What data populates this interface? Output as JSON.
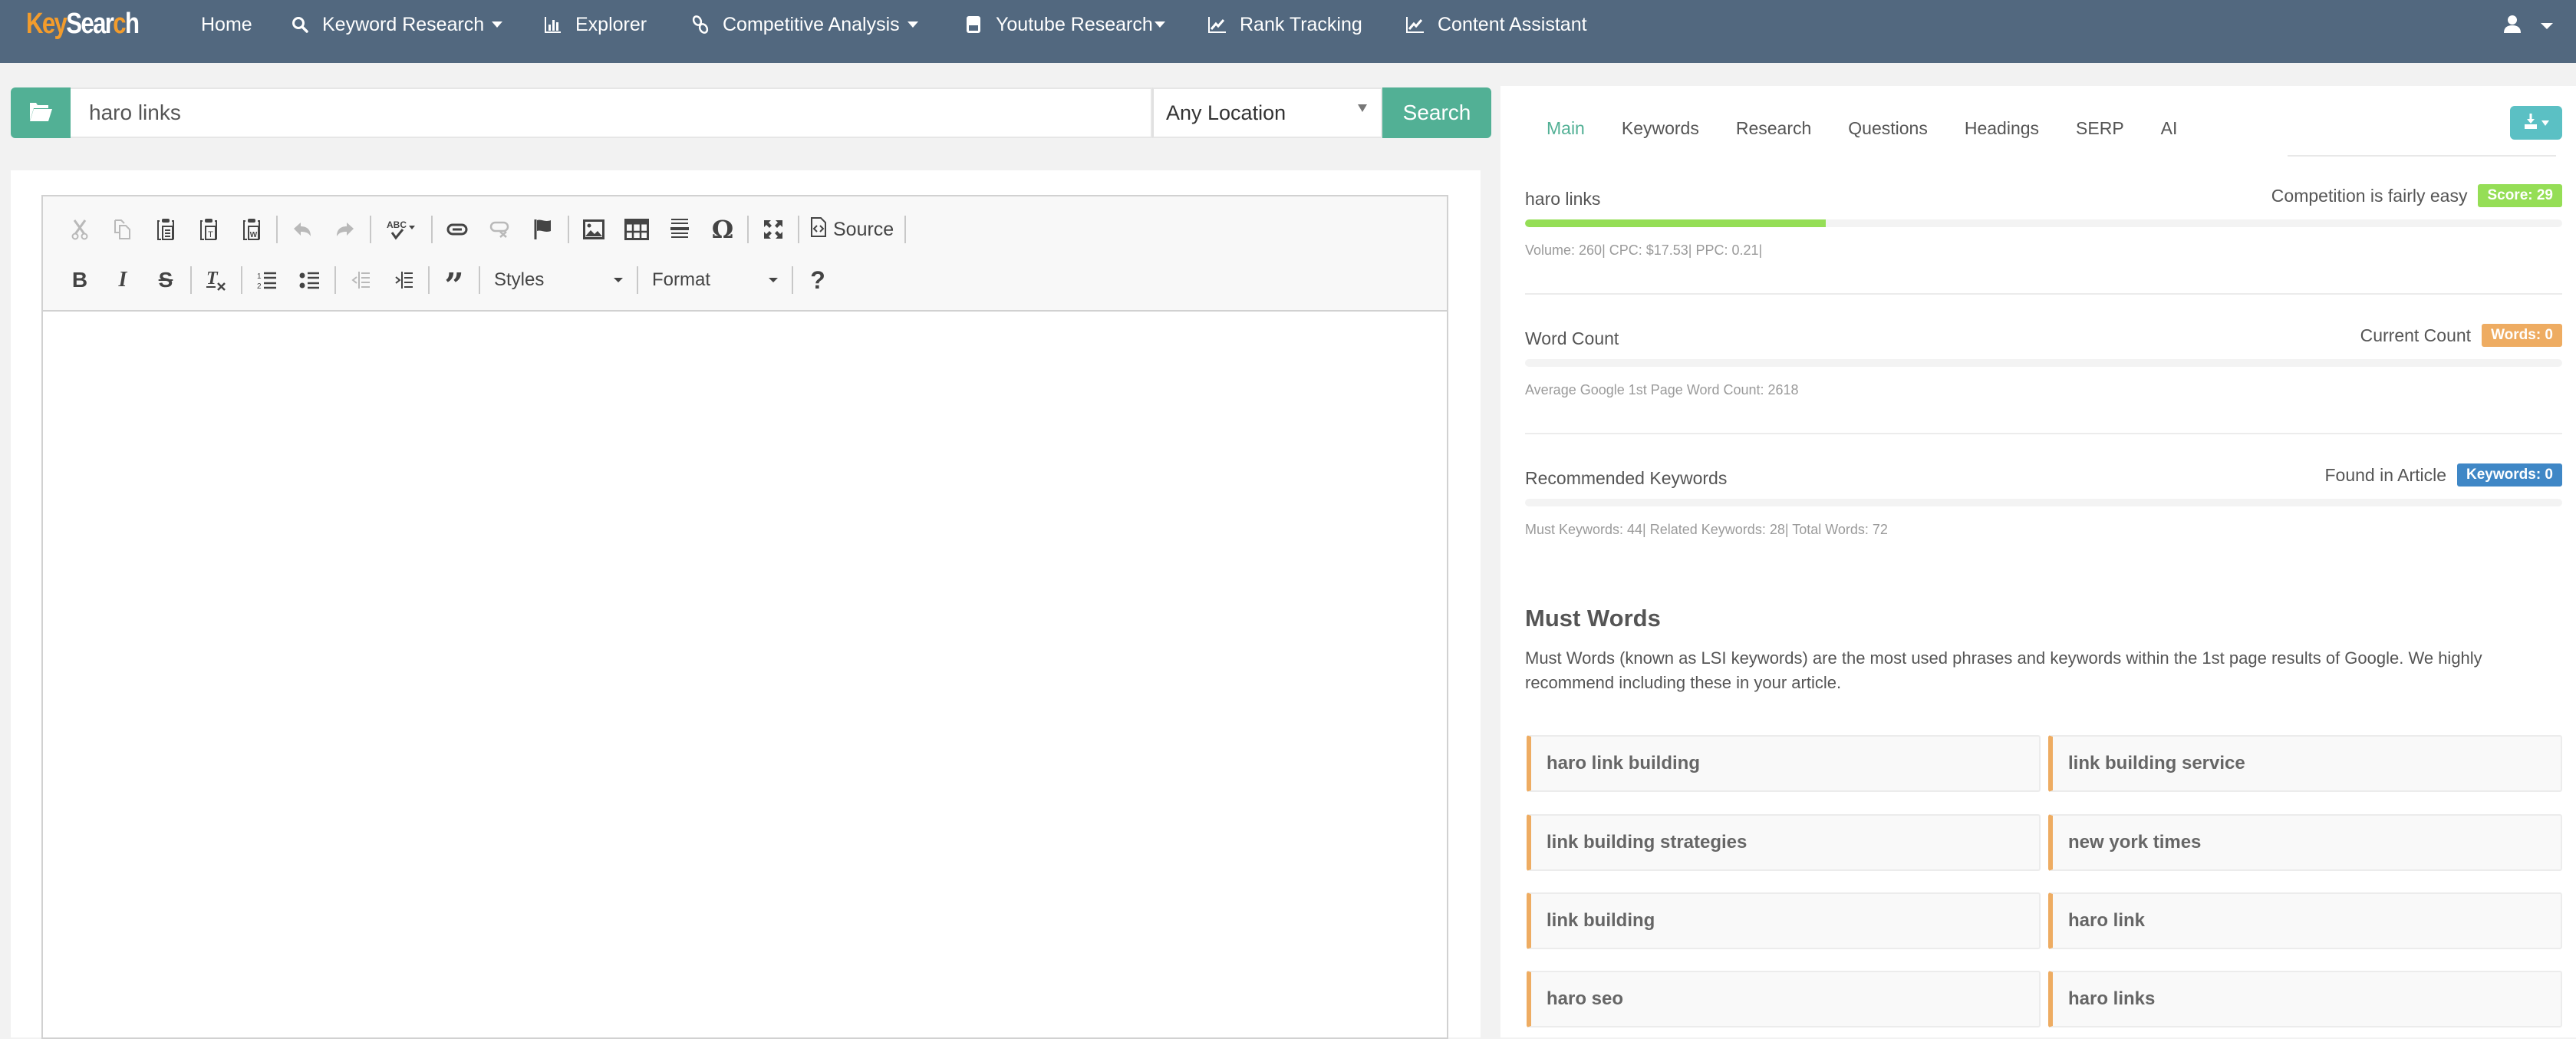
{
  "navbar": {
    "logo": {
      "part1": "Key",
      "part2": "Sear",
      "part3": "c",
      "part4": "h"
    },
    "items": [
      {
        "label": "Home",
        "icon": "none",
        "has_caret": false
      },
      {
        "label": "Keyword Research",
        "icon": "search-icon",
        "has_caret": true
      },
      {
        "label": "Explorer",
        "icon": "bar-chart-icon",
        "has_caret": false
      },
      {
        "label": "Competitive Analysis",
        "icon": "link-icon",
        "has_caret": true
      },
      {
        "label": "Youtube Research",
        "icon": "youtube-icon",
        "has_caret": true
      },
      {
        "label": "Rank Tracking",
        "icon": "line-chart-icon",
        "has_caret": false
      },
      {
        "label": "Content Assistant",
        "icon": "line-chart-icon",
        "has_caret": false
      }
    ],
    "user_icon": "user-icon"
  },
  "search": {
    "keyword_value": "haro links",
    "location_value": "Any Location",
    "search_label": "Search"
  },
  "editor": {
    "toolbar_row1": [
      "Cut",
      "Copy",
      "Paste",
      "Paste as plain text",
      "Paste from Word",
      "Undo",
      "Redo",
      "Spell Check",
      "Link",
      "Unlink",
      "Anchor",
      "Image",
      "Table",
      "Horizontal Line",
      "Special Character",
      "Maximize"
    ],
    "source_label": "Source",
    "toolbar_row2": [
      "Bold",
      "Italic",
      "Strikethrough",
      "Remove Format",
      "Numbered List",
      "Bulleted List",
      "Decrease Indent",
      "Increase Indent",
      "Block Quote"
    ],
    "styles_label": "Styles",
    "format_label": "Format",
    "help_label": "?",
    "content": ""
  },
  "right_panel": {
    "tabs": [
      {
        "label": "Main",
        "active": true
      },
      {
        "label": "Keywords",
        "active": false
      },
      {
        "label": "Research",
        "active": false
      },
      {
        "label": "Questions",
        "active": false
      },
      {
        "label": "Headings",
        "active": false
      },
      {
        "label": "SERP",
        "active": false
      },
      {
        "label": "AI",
        "active": false
      }
    ],
    "keyword_metric": {
      "label": "haro links",
      "status": "Competition is fairly easy",
      "badge": "Score: 29",
      "badge_color": "#95de56",
      "progress_percent": 29,
      "sub": "Volume: 260| CPC: $17.53| PPC: 0.21|"
    },
    "word_count": {
      "label": "Word Count",
      "status": "Current Count",
      "badge": "Words: 0",
      "badge_color": "#eeac62",
      "progress_percent": 0,
      "sub": "Average Google 1st Page Word Count: 2618"
    },
    "recommended": {
      "label": "Recommended Keywords",
      "status": "Found in Article",
      "badge": "Keywords: 0",
      "badge_color": "#3f87c6",
      "progress_percent": 0,
      "sub": "Must Keywords: 44| Related Keywords: 28| Total Words: 72"
    },
    "must_words": {
      "title": "Must Words",
      "description": "Must Words (known as LSI keywords) are the most used phrases and keywords within the 1st page results of Google. We highly recommend including these in your article.",
      "items": [
        "haro link building",
        "link building service",
        "link building strategies",
        "new york times",
        "link building",
        "haro link",
        "haro seo",
        "haro links"
      ]
    }
  },
  "colors": {
    "navbar": "#52687f",
    "primary_green": "#52b095",
    "export_teal": "#5bc0c4",
    "card_accent": "#eeac62"
  }
}
